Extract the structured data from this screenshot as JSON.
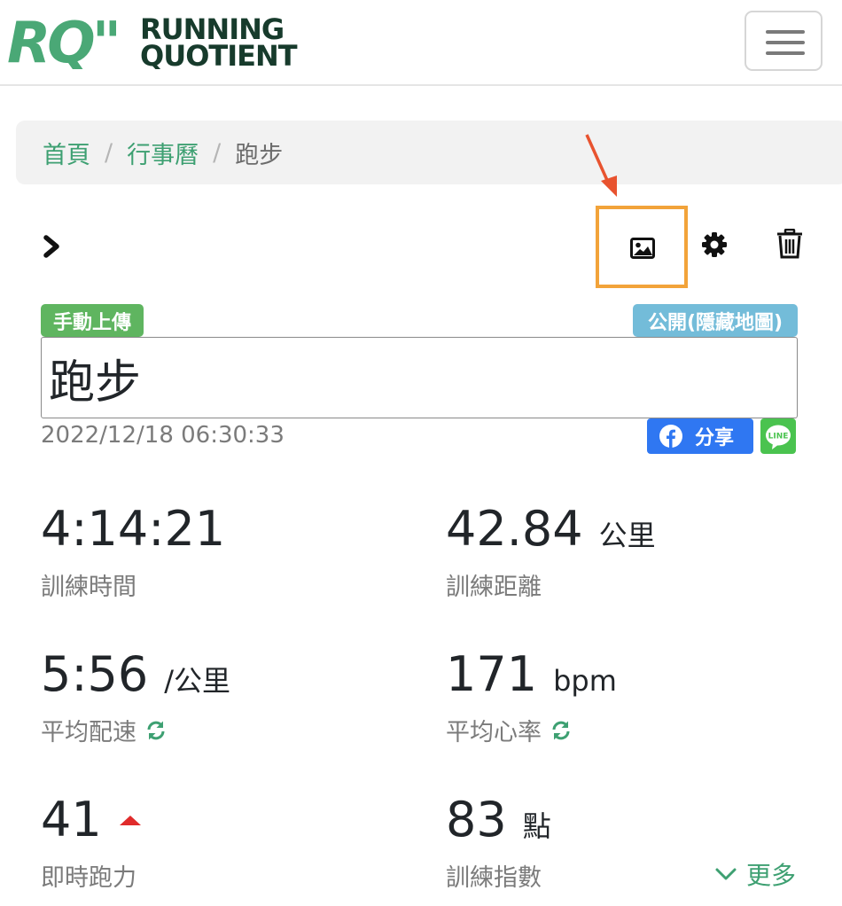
{
  "header": {
    "logo_mark": "RQ\"",
    "logo_line1": "RUNNING",
    "logo_line2": "QUOTIENT",
    "menu_icon": "hamburger-icon"
  },
  "breadcrumb": {
    "items": [
      "首頁",
      "行事曆",
      "跑步"
    ],
    "separator": "/"
  },
  "toolbar": {
    "icons": [
      "chevron-right-icon",
      "image-icon",
      "gear-icon",
      "trash-icon"
    ],
    "highlight_color": "#f2a33a",
    "arrow_color": "#e8532f"
  },
  "activity": {
    "upload_badge": "手動上傳",
    "visibility_badge": "公開(隱藏地圖)",
    "title": "跑步",
    "datetime": "2022/12/18 06:30:33",
    "share_label": "分享"
  },
  "stats": [
    {
      "value": "4:14:21",
      "unit": "",
      "label": "訓練時間"
    },
    {
      "value": "42.84",
      "unit": "公里",
      "label": "訓練距離"
    },
    {
      "value": "5:56",
      "unit": "/公里",
      "label": "平均配速"
    },
    {
      "value": "171",
      "unit": "bpm",
      "label": "平均心率"
    },
    {
      "value": "41",
      "unit": "",
      "label": "即時跑力"
    },
    {
      "value": "83",
      "unit": "點",
      "label": "訓練指數"
    }
  ],
  "more_label": "更多",
  "colors": {
    "brand_green": "#3ea072",
    "badge_green": "#5fb560",
    "badge_blue": "#73bcd9",
    "facebook_blue": "#2f77f2",
    "line_green": "#4ac34f",
    "trend_up_red": "#e02b2b"
  }
}
